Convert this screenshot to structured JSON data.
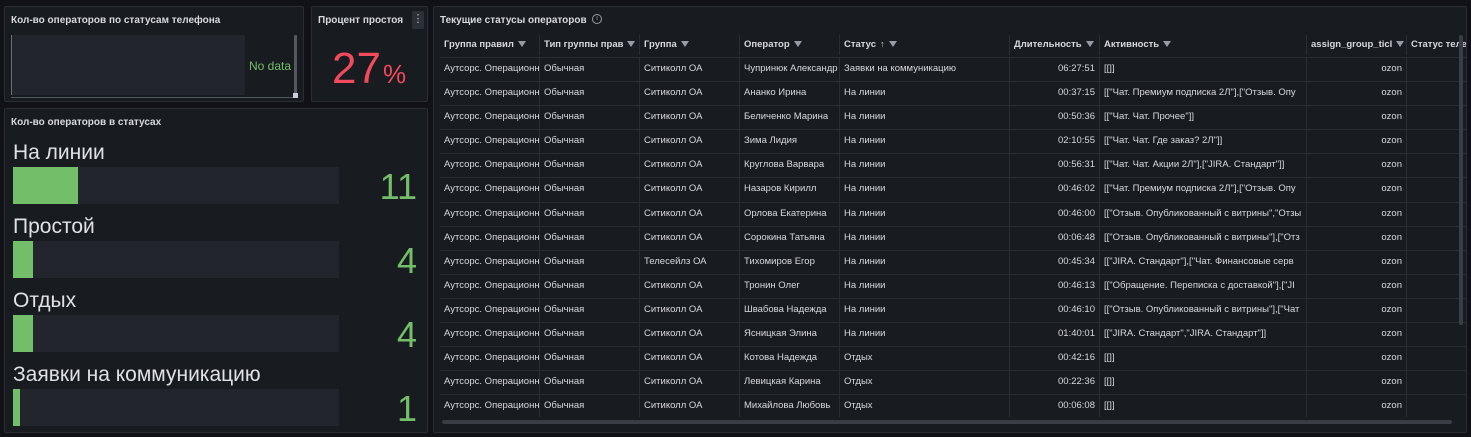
{
  "panels": {
    "phone": {
      "title": "Кол-во операторов по статусам телефона",
      "empty_text": "No data"
    },
    "idle": {
      "title": "Процент простоя",
      "value": "27",
      "unit": "%",
      "menu_icon": "⋮",
      "value_color": "#f2495c"
    },
    "statuses": {
      "title": "Кол-во операторов в статусах",
      "max": 11,
      "accent": "#73bf69",
      "items": [
        {
          "label": "На линии",
          "value": "11",
          "fill_ratio": 0.05
        },
        {
          "label": "Простой",
          "value": "4",
          "fill_ratio": 0.015
        },
        {
          "label": "Отдых",
          "value": "4",
          "fill_ratio": 0.015
        },
        {
          "label": "Заявки на коммуникацию",
          "value": "1",
          "fill_ratio": 0.005
        }
      ]
    },
    "table": {
      "title": "Текущие статусы операторов",
      "info_icon": "i",
      "columns": [
        "Группа правил",
        "Тип группы прав",
        "Группа",
        "Оператор",
        "Статус",
        "Длительность",
        "Активность",
        "assign_group_ticl",
        "Статус теле"
      ],
      "sort_icon": "↑",
      "rows": [
        [
          "Аутсорс. Операционн",
          "Обычная",
          "Ситиколл ОА",
          "Чупринюк Александр",
          "Заявки на коммуникацию",
          "06:27:51",
          "[[]]",
          "ozon",
          ""
        ],
        [
          "Аутсорс. Операционн",
          "Обычная",
          "Ситиколл ОА",
          "Ананко Ирина",
          "На линии",
          "00:37:15",
          "[[\"Чат. Премиум подписка 2Л\"],[\"Отзыв. Опу",
          "ozon",
          ""
        ],
        [
          "Аутсорс. Операционн",
          "Обычная",
          "Ситиколл ОА",
          "Беличенко Марина",
          "На линии",
          "00:50:36",
          "[[\"Чат. Чат. Прочее\"]]",
          "ozon",
          ""
        ],
        [
          "Аутсорс. Операционн",
          "Обычная",
          "Ситиколл ОА",
          "Зима Лидия",
          "На линии",
          "02:10:55",
          "[[\"Чат. Чат. Где заказ? 2Л\"]]",
          "ozon",
          ""
        ],
        [
          "Аутсорс. Операционн",
          "Обычная",
          "Ситиколл ОА",
          "Круглова Варвара",
          "На линии",
          "00:56:31",
          "[[\"Чат. Чат. Акции 2Л\"],[\"JIRA. Стандарт\"]]",
          "ozon",
          ""
        ],
        [
          "Аутсорс. Операционн",
          "Обычная",
          "Ситиколл ОА",
          "Назаров Кирилл",
          "На линии",
          "00:46:02",
          "[[\"Чат. Премиум подписка 2Л\"],[\"Отзыв. Опу",
          "ozon",
          ""
        ],
        [
          "Аутсорс. Операционн",
          "Обычная",
          "Ситиколл ОА",
          "Орлова Екатерина",
          "На линии",
          "00:46:00",
          "[[\"Отзыв. Опубликованный с витрины\",\"Отзы",
          "ozon",
          ""
        ],
        [
          "Аутсорс. Операционн",
          "Обычная",
          "Ситиколл ОА",
          "Сорокина Татьяна",
          "На линии",
          "00:06:48",
          "[[\"Отзыв. Опубликованный с витрины\"],[\"Отз",
          "ozon",
          ""
        ],
        [
          "Аутсорс. Операционн",
          "Обычная",
          "Телесейлз ОА",
          "Тихомиров Егор",
          "На линии",
          "00:45:34",
          "[[\"JIRA. Стандарт\"],[\"Чат. Финансовые серв",
          "ozon",
          ""
        ],
        [
          "Аутсорс. Операционн",
          "Обычная",
          "Ситиколл ОА",
          "Тронин Олег",
          "На линии",
          "00:46:13",
          "[[\"Обращение. Переписка с доставкой\"],[\"JI",
          "ozon",
          ""
        ],
        [
          "Аутсорс. Операционн",
          "Обычная",
          "Ситиколл ОА",
          "Швабова Надежда",
          "На линии",
          "00:46:10",
          "[[\"Отзыв. Опубликованный с витрины\"],[\"Чат",
          "ozon",
          ""
        ],
        [
          "Аутсорс. Операционн",
          "Обычная",
          "Ситиколл ОА",
          "Ясницкая Элина",
          "На линии",
          "01:40:01",
          "[[\"JIRA. Стандарт\",\"JIRA. Стандарт\"]]",
          "ozon",
          ""
        ],
        [
          "Аутсорс. Операционн",
          "Обычная",
          "Ситиколл ОА",
          "Котова Надежда",
          "Отдых",
          "00:42:16",
          "[[]]",
          "ozon",
          ""
        ],
        [
          "Аутсорс. Операционн",
          "Обычная",
          "Ситиколл ОА",
          "Левицкая Карина",
          "Отдых",
          "00:22:36",
          "[[]]",
          "ozon",
          ""
        ],
        [
          "Аутсорс. Операционн",
          "Обычная",
          "Ситиколл ОА",
          "Михайлова Любовь",
          "Отдых",
          "00:06:08",
          "[[]]",
          "ozon",
          ""
        ]
      ]
    }
  }
}
